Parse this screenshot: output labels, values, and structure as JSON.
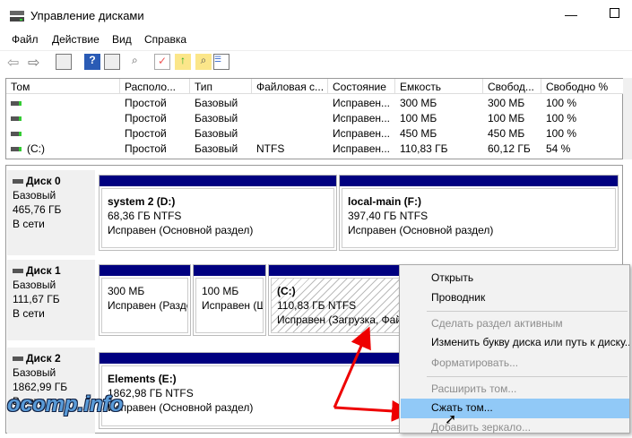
{
  "window": {
    "title": "Управление дисками"
  },
  "menu": [
    "Файл",
    "Действие",
    "Вид",
    "Справка"
  ],
  "toolbar": [
    "back-icon",
    "forward-icon",
    "console-tree-icon",
    "help-icon",
    "action-pane-icon",
    "connect-drive-icon",
    "check-icon",
    "upload-icon",
    "search-icon",
    "properties-icon"
  ],
  "table": {
    "headers": [
      "Том",
      "Располо...",
      "Тип",
      "Файловая с...",
      "Состояние",
      "Емкость",
      "Свобод...",
      "Свободно %"
    ],
    "rows": [
      [
        "",
        "Простой",
        "Базовый",
        "",
        "Исправен...",
        "300 МБ",
        "300 МБ",
        "100 %"
      ],
      [
        "",
        "Простой",
        "Базовый",
        "",
        "Исправен...",
        "100 МБ",
        "100 МБ",
        "100 %"
      ],
      [
        "",
        "Простой",
        "Базовый",
        "",
        "Исправен...",
        "450 МБ",
        "450 МБ",
        "100 %"
      ],
      [
        "(C:)",
        "Простой",
        "Базовый",
        "NTFS",
        "Исправен...",
        "110,83 ГБ",
        "60,12 ГБ",
        "54 %"
      ]
    ]
  },
  "disks": [
    {
      "name": "Диск 0",
      "type": "Базовый",
      "size": "465,76 ГБ",
      "status": "В сети",
      "parts": [
        {
          "label": "system 2  (D:)",
          "size": "68,36 ГБ NTFS",
          "status": "Исправен (Основной раздел)"
        },
        {
          "label": "local-main  (F:)",
          "size": "397,40 ГБ NTFS",
          "status": "Исправен (Основной раздел)"
        }
      ]
    },
    {
      "name": "Диск 1",
      "type": "Базовый",
      "size": "111,67 ГБ",
      "status": "В сети",
      "parts": [
        {
          "label": "",
          "size": "300 МБ",
          "status": "Исправен (Разде"
        },
        {
          "label": "",
          "size": "100 МБ",
          "status": "Исправен (Ш"
        },
        {
          "label": "(C:)",
          "size": "110,83 ГБ NTFS",
          "status": "Исправен (Загрузка, Фай."
        }
      ]
    },
    {
      "name": "Диск 2",
      "type": "Базовый",
      "size": "1862,99 ГБ",
      "status": "В сети",
      "parts": [
        {
          "label": "Elements  (E:)",
          "size": "1862,98 ГБ NTFS",
          "status": "Исправен (Основной раздел)"
        }
      ]
    }
  ],
  "context_menu": [
    "Открыть",
    "Проводник",
    "Сделать раздел активным",
    "Изменить букву диска или путь к диску...",
    "Форматировать...",
    "Расширить том...",
    "Сжать том...",
    "Добавить зеркало..."
  ],
  "watermark": "ocomp.info"
}
